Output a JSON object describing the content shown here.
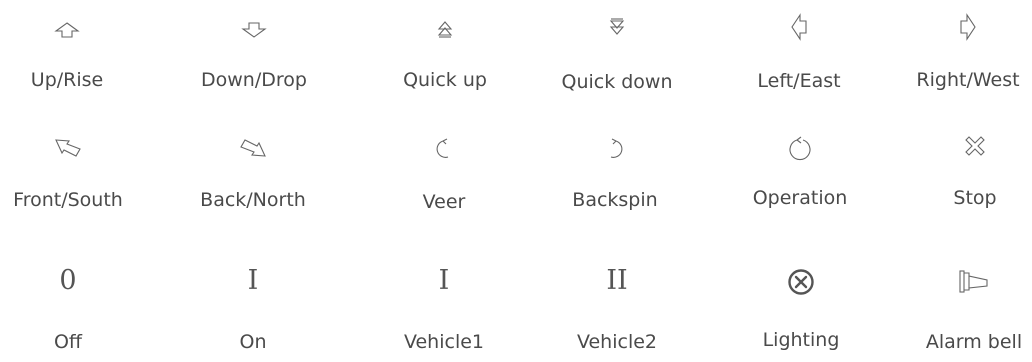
{
  "colors": {
    "background": "#ffffff",
    "text": "#4a4a4a",
    "icon_stroke": "#666666"
  },
  "symbols": [
    {
      "label": "Up/Rise",
      "icon": "arrow-up-outline-icon"
    },
    {
      "label": "Down/Drop",
      "icon": "arrow-down-outline-icon"
    },
    {
      "label": "Quick up",
      "icon": "double-chevron-up-icon"
    },
    {
      "label": "Quick down",
      "icon": "double-chevron-down-icon"
    },
    {
      "label": "Left/East",
      "icon": "arrow-left-outline-icon"
    },
    {
      "label": "Right/West",
      "icon": "arrow-right-outline-icon"
    },
    {
      "label": "Front/South",
      "icon": "arrow-diagonal-front-icon"
    },
    {
      "label": "Back/North",
      "icon": "arrow-diagonal-back-icon"
    },
    {
      "label": "Veer",
      "icon": "arc-arrow-ccw-icon"
    },
    {
      "label": "Backspin",
      "icon": "arc-arrow-cw-icon"
    },
    {
      "label": "Operation",
      "icon": "circle-arrow-icon"
    },
    {
      "label": "Stop",
      "icon": "cross-x-icon"
    },
    {
      "label": "Off",
      "icon": "numeral-zero-icon",
      "glyph": "0"
    },
    {
      "label": "On",
      "icon": "numeral-one-icon",
      "glyph": "I"
    },
    {
      "label": "Vehicle1",
      "icon": "numeral-one-icon",
      "glyph": "I"
    },
    {
      "label": "Vehicle2",
      "icon": "numeral-two-icon",
      "glyph": "II"
    },
    {
      "label": "Lighting",
      "icon": "circle-x-icon"
    },
    {
      "label": "Alarm bell",
      "icon": "flag-bell-icon"
    }
  ]
}
